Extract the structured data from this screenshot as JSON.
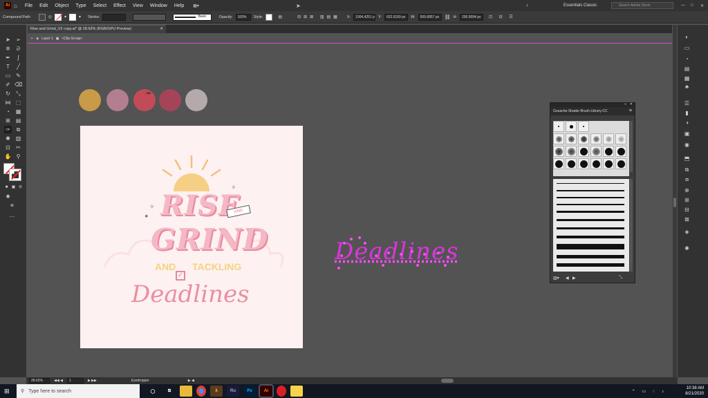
{
  "menu": {
    "app_icon": "Ai",
    "items": [
      "File",
      "Edit",
      "Object",
      "Type",
      "Select",
      "Effect",
      "View",
      "Window",
      "Help"
    ],
    "workspace": "Essentials Classic",
    "search_placeholder": "Search Adobe Stock"
  },
  "control": {
    "selection_label": "Compound Path",
    "stroke_label": "Stroke:",
    "brush_style": "Basic",
    "opacity_label": "Opacity:",
    "opacity_value": "100%",
    "style_label": "Style:",
    "x_label": "X:",
    "x_value": "1004.4251 p",
    "y_label": "Y:",
    "y_value": "622.6159 px",
    "w_label": "W:",
    "w_value": "509.6857 px",
    "h_label": "H:",
    "h_value": "200.9094 px"
  },
  "document": {
    "tab_title": "Rise and Grind_V2 copy.ai* @ 28.62% (RGB/GPU Preview)",
    "breadcrumb_layer": "Layer 1",
    "breadcrumb_group": "<Clip Group>"
  },
  "artwork": {
    "swatches": [
      "#c99a48",
      "#b27e90",
      "#c14c57",
      "#a54458",
      "#b4aaab"
    ],
    "line1": "RISE",
    "and_small": "AND",
    "line2": "GRIND",
    "line3_and": "AND",
    "line3_tackling": "TACKLING",
    "script": "Deadlines",
    "selected_script": "Deadlines"
  },
  "brush_panel": {
    "title": "Gouache-Shader-Brush-Library-CC"
  },
  "status": {
    "zoom": "28.62%",
    "artboard_num": "1",
    "tool": "Eyedropper"
  },
  "taskbar": {
    "search_placeholder": "Type here to search",
    "apps": [
      "λ",
      "Ru",
      "Ps",
      "Ai"
    ],
    "time": "10:38 AM",
    "date": "8/21/2020"
  }
}
